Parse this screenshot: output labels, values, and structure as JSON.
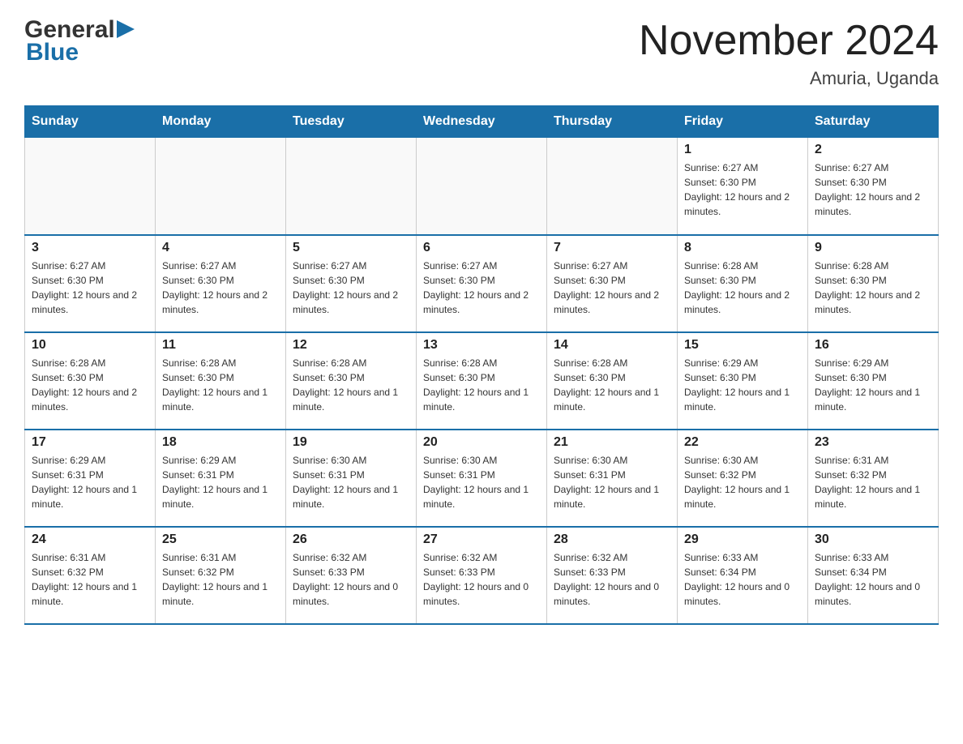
{
  "header": {
    "logo_general": "General",
    "logo_blue": "Blue",
    "month_title": "November 2024",
    "location": "Amuria, Uganda"
  },
  "days_of_week": [
    "Sunday",
    "Monday",
    "Tuesday",
    "Wednesday",
    "Thursday",
    "Friday",
    "Saturday"
  ],
  "weeks": [
    {
      "days": [
        {
          "num": "",
          "info": ""
        },
        {
          "num": "",
          "info": ""
        },
        {
          "num": "",
          "info": ""
        },
        {
          "num": "",
          "info": ""
        },
        {
          "num": "",
          "info": ""
        },
        {
          "num": "1",
          "info": "Sunrise: 6:27 AM\nSunset: 6:30 PM\nDaylight: 12 hours and 2 minutes."
        },
        {
          "num": "2",
          "info": "Sunrise: 6:27 AM\nSunset: 6:30 PM\nDaylight: 12 hours and 2 minutes."
        }
      ]
    },
    {
      "days": [
        {
          "num": "3",
          "info": "Sunrise: 6:27 AM\nSunset: 6:30 PM\nDaylight: 12 hours and 2 minutes."
        },
        {
          "num": "4",
          "info": "Sunrise: 6:27 AM\nSunset: 6:30 PM\nDaylight: 12 hours and 2 minutes."
        },
        {
          "num": "5",
          "info": "Sunrise: 6:27 AM\nSunset: 6:30 PM\nDaylight: 12 hours and 2 minutes."
        },
        {
          "num": "6",
          "info": "Sunrise: 6:27 AM\nSunset: 6:30 PM\nDaylight: 12 hours and 2 minutes."
        },
        {
          "num": "7",
          "info": "Sunrise: 6:27 AM\nSunset: 6:30 PM\nDaylight: 12 hours and 2 minutes."
        },
        {
          "num": "8",
          "info": "Sunrise: 6:28 AM\nSunset: 6:30 PM\nDaylight: 12 hours and 2 minutes."
        },
        {
          "num": "9",
          "info": "Sunrise: 6:28 AM\nSunset: 6:30 PM\nDaylight: 12 hours and 2 minutes."
        }
      ]
    },
    {
      "days": [
        {
          "num": "10",
          "info": "Sunrise: 6:28 AM\nSunset: 6:30 PM\nDaylight: 12 hours and 2 minutes."
        },
        {
          "num": "11",
          "info": "Sunrise: 6:28 AM\nSunset: 6:30 PM\nDaylight: 12 hours and 1 minute."
        },
        {
          "num": "12",
          "info": "Sunrise: 6:28 AM\nSunset: 6:30 PM\nDaylight: 12 hours and 1 minute."
        },
        {
          "num": "13",
          "info": "Sunrise: 6:28 AM\nSunset: 6:30 PM\nDaylight: 12 hours and 1 minute."
        },
        {
          "num": "14",
          "info": "Sunrise: 6:28 AM\nSunset: 6:30 PM\nDaylight: 12 hours and 1 minute."
        },
        {
          "num": "15",
          "info": "Sunrise: 6:29 AM\nSunset: 6:30 PM\nDaylight: 12 hours and 1 minute."
        },
        {
          "num": "16",
          "info": "Sunrise: 6:29 AM\nSunset: 6:30 PM\nDaylight: 12 hours and 1 minute."
        }
      ]
    },
    {
      "days": [
        {
          "num": "17",
          "info": "Sunrise: 6:29 AM\nSunset: 6:31 PM\nDaylight: 12 hours and 1 minute."
        },
        {
          "num": "18",
          "info": "Sunrise: 6:29 AM\nSunset: 6:31 PM\nDaylight: 12 hours and 1 minute."
        },
        {
          "num": "19",
          "info": "Sunrise: 6:30 AM\nSunset: 6:31 PM\nDaylight: 12 hours and 1 minute."
        },
        {
          "num": "20",
          "info": "Sunrise: 6:30 AM\nSunset: 6:31 PM\nDaylight: 12 hours and 1 minute."
        },
        {
          "num": "21",
          "info": "Sunrise: 6:30 AM\nSunset: 6:31 PM\nDaylight: 12 hours and 1 minute."
        },
        {
          "num": "22",
          "info": "Sunrise: 6:30 AM\nSunset: 6:32 PM\nDaylight: 12 hours and 1 minute."
        },
        {
          "num": "23",
          "info": "Sunrise: 6:31 AM\nSunset: 6:32 PM\nDaylight: 12 hours and 1 minute."
        }
      ]
    },
    {
      "days": [
        {
          "num": "24",
          "info": "Sunrise: 6:31 AM\nSunset: 6:32 PM\nDaylight: 12 hours and 1 minute."
        },
        {
          "num": "25",
          "info": "Sunrise: 6:31 AM\nSunset: 6:32 PM\nDaylight: 12 hours and 1 minute."
        },
        {
          "num": "26",
          "info": "Sunrise: 6:32 AM\nSunset: 6:33 PM\nDaylight: 12 hours and 0 minutes."
        },
        {
          "num": "27",
          "info": "Sunrise: 6:32 AM\nSunset: 6:33 PM\nDaylight: 12 hours and 0 minutes."
        },
        {
          "num": "28",
          "info": "Sunrise: 6:32 AM\nSunset: 6:33 PM\nDaylight: 12 hours and 0 minutes."
        },
        {
          "num": "29",
          "info": "Sunrise: 6:33 AM\nSunset: 6:34 PM\nDaylight: 12 hours and 0 minutes."
        },
        {
          "num": "30",
          "info": "Sunrise: 6:33 AM\nSunset: 6:34 PM\nDaylight: 12 hours and 0 minutes."
        }
      ]
    }
  ]
}
